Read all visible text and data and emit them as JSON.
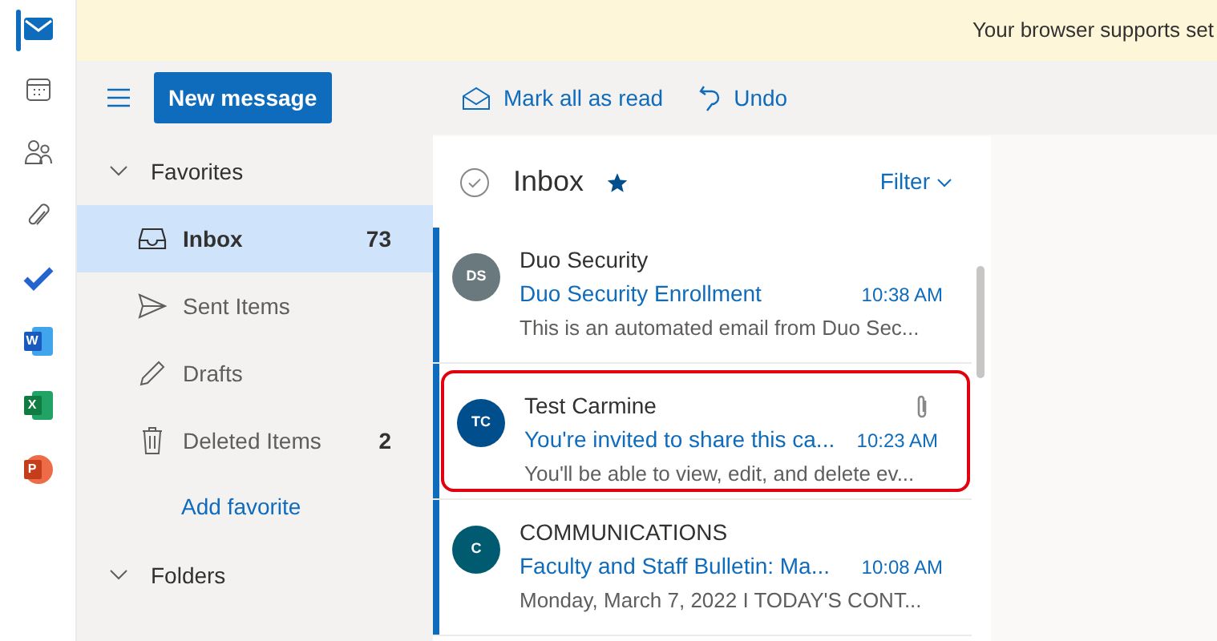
{
  "banner": {
    "text": "Your browser supports set"
  },
  "rail": [
    {
      "kind": "mail",
      "selected": true
    },
    {
      "kind": "calendar",
      "selected": false
    },
    {
      "kind": "people",
      "selected": false
    },
    {
      "kind": "files",
      "selected": false
    },
    {
      "kind": "todo",
      "selected": false
    },
    {
      "kind": "word",
      "label": "W",
      "selected": false
    },
    {
      "kind": "excel",
      "label": "X",
      "selected": false
    },
    {
      "kind": "powerpoint",
      "label": "P",
      "selected": false
    }
  ],
  "new_message": "New message",
  "toolbar": [
    {
      "kind": "mark-read",
      "label": "Mark all as read"
    },
    {
      "kind": "undo",
      "label": "Undo"
    }
  ],
  "favorites": {
    "title": "Favorites",
    "expanded": true,
    "items": [
      {
        "kind": "inbox",
        "label": "Inbox",
        "count": "73",
        "selected": true
      },
      {
        "kind": "sent",
        "label": "Sent Items",
        "selected": false
      },
      {
        "kind": "drafts",
        "label": "Drafts",
        "selected": false
      },
      {
        "kind": "deleted",
        "label": "Deleted Items",
        "count": "2",
        "selected": false
      }
    ],
    "add_link": "Add favorite"
  },
  "folders": {
    "title": "Folders",
    "expanded": true
  },
  "list": {
    "title": "Inbox",
    "favorite": true,
    "filter": "Filter"
  },
  "messages": [
    {
      "initials": "DS",
      "color": "#69797e",
      "sender": "Duo Security",
      "subject": "Duo Security Enrollment",
      "time": "10:38 AM",
      "preview": "This is an automated email from Duo Sec...",
      "unread": true,
      "attachment": false,
      "highlighted": false
    },
    {
      "initials": "TC",
      "color": "#004e8c",
      "sender": "Test Carmine",
      "subject": "You're invited to share this ca...",
      "time": "10:23 AM",
      "preview": "You'll be able to view, edit, and delete ev...",
      "unread": true,
      "attachment": true,
      "highlighted": true
    },
    {
      "initials": "C",
      "color": "#005b70",
      "sender": "COMMUNICATIONS",
      "subject": "Faculty and Staff Bulletin: Ma...",
      "time": "10:08 AM",
      "preview": "Monday, March 7, 2022 I TODAY'S CONT...",
      "unread": true,
      "attachment": false,
      "highlighted": false
    }
  ]
}
